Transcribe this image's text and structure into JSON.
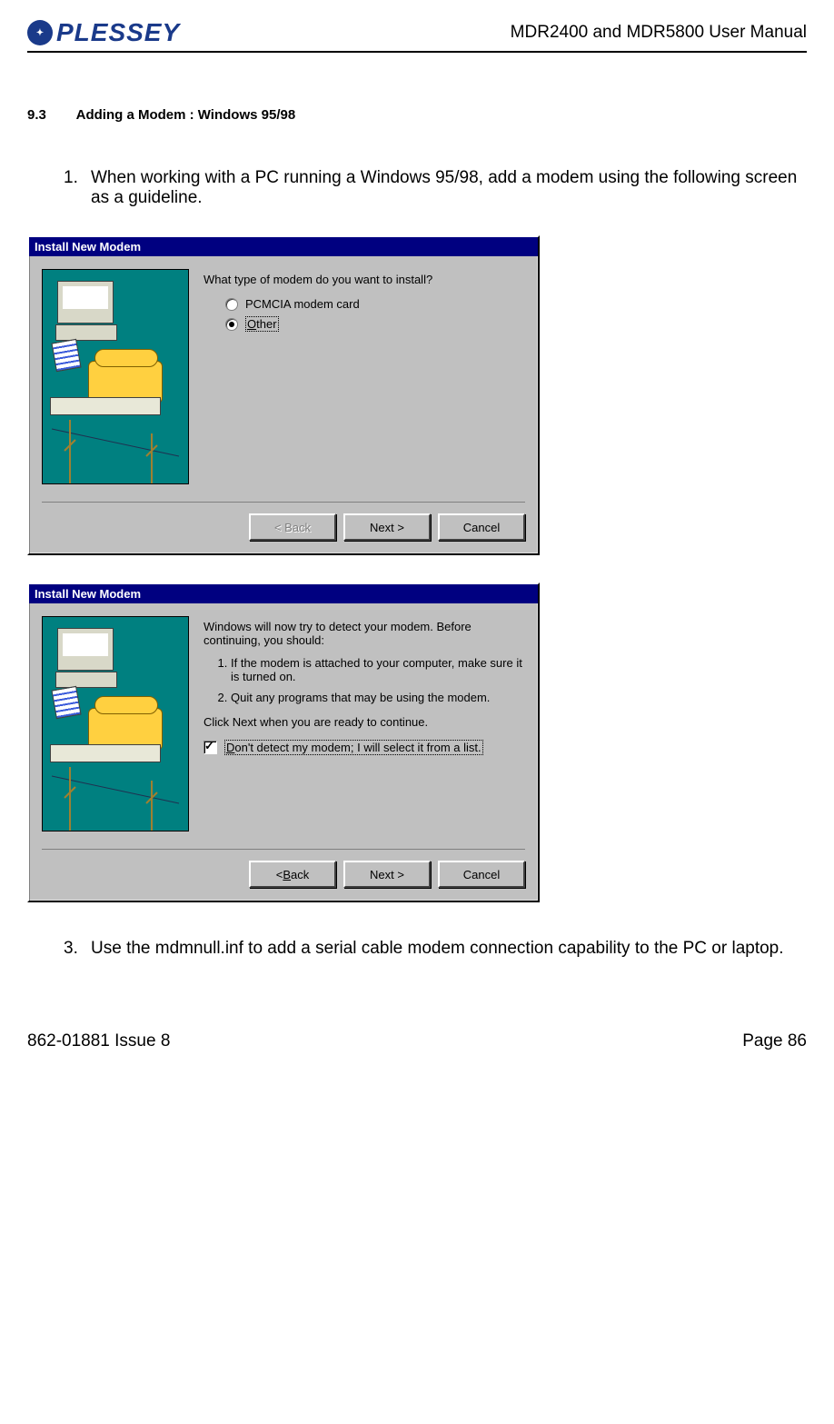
{
  "header": {
    "logo_text": "PLESSEY",
    "doc_title": "MDR2400 and MDR5800 User Manual"
  },
  "section": {
    "number": "9.3",
    "title": "Adding a Modem : Windows 95/98"
  },
  "steps": {
    "one_number": "1.",
    "one_text": "When working with a PC running a Windows 95/98, add a modem using the following screen as a guideline.",
    "three_number": "3.",
    "three_text": "Use the mdmnull.inf to add a serial cable modem connection capability to the PC or laptop."
  },
  "dialog1": {
    "title": "Install New Modem",
    "question": "What type of modem do you want to install?",
    "option1": "PCMCIA modem card",
    "option2_underline": "O",
    "option2_rest": "ther",
    "back": "< Back",
    "next": "Next >",
    "cancel": "Cancel"
  },
  "dialog2": {
    "title": "Install New Modem",
    "intro": "Windows will now try to detect your modem.  Before continuing, you should:",
    "li1": "If the modem is attached to your computer, make sure it is turned on.",
    "li2": "Quit any programs that may be using the modem.",
    "ready": "Click Next when you are ready to continue.",
    "check_underline": "D",
    "check_rest": "on't detect my modem; I will select it from a list.",
    "back_u": "B",
    "back_pre": "< ",
    "back_post": "ack",
    "next": "Next >",
    "cancel": "Cancel"
  },
  "footer": {
    "left": "862-01881 Issue 8",
    "right": "Page 86"
  }
}
